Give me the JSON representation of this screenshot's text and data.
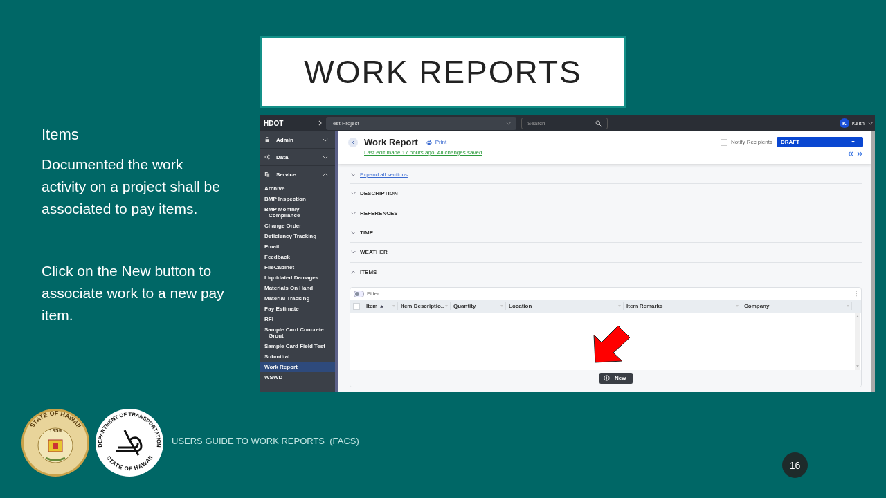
{
  "slide": {
    "title": "WORK REPORTS",
    "heading": "Items",
    "paragraphs": [
      [
        "Documented the work",
        "activity on a project shall be",
        "associated to pay items."
      ],
      [
        "Click on the New button to",
        "associate work to a new pay",
        "item."
      ]
    ],
    "state_seal": {
      "top": "STATE OF HAWAII",
      "year": "1959"
    },
    "dot_seal": {
      "top": "DEPARTMENT OF TRANSPORTATION",
      "bottom": "STATE OF HAWAII"
    },
    "footer": "USERS GUIDE TO WORK REPORTS  (FACS)",
    "page_number": "16"
  },
  "app": {
    "topbar": {
      "brand": "HDOT",
      "project": "Test Project",
      "search_placeholder": "Search",
      "user_initial": "K",
      "user_name": "Keith"
    },
    "sidebar": {
      "groups": [
        {
          "label": "Admin",
          "expanded": false
        },
        {
          "label": "Data",
          "expanded": false
        },
        {
          "label": "Service",
          "expanded": true
        }
      ],
      "items": [
        {
          "label": "Archive",
          "selected": false
        },
        {
          "label": "BMP Inspection",
          "selected": false
        },
        {
          "label": "BMP Monthly",
          "label_2": "Compliance",
          "selected": false
        },
        {
          "label": "Change Order",
          "selected": false
        },
        {
          "label": "Deficiency Tracking",
          "selected": false
        },
        {
          "label": "Email",
          "selected": false
        },
        {
          "label": "Feedback",
          "selected": false
        },
        {
          "label": "FileCabinet",
          "selected": false
        },
        {
          "label": "Liquidated Damages",
          "selected": false
        },
        {
          "label": "Materials On Hand",
          "selected": false
        },
        {
          "label": "Material Tracking",
          "selected": false
        },
        {
          "label": "Pay Estimate",
          "selected": false
        },
        {
          "label": "RFI",
          "selected": false
        },
        {
          "label": "Sample Card Concrete",
          "label_2": "Grout",
          "selected": false
        },
        {
          "label": "Sample Card Field Test",
          "selected": false
        },
        {
          "label": "Submittal",
          "selected": false
        },
        {
          "label": "Work Report",
          "selected": true
        },
        {
          "label": "WSWD",
          "selected": false
        }
      ]
    },
    "header": {
      "title": "Work Report",
      "print": "Print",
      "last_edit": "Last edit made 17 hours ago. All changes saved",
      "notify": {
        "label": "Notify Recipients",
        "checked": false
      },
      "status": "DRAFT"
    },
    "sections": {
      "expand_all": "Expand all sections",
      "list": [
        {
          "title": "DESCRIPTION",
          "expanded": false
        },
        {
          "title": "REFERENCES",
          "expanded": false
        },
        {
          "title": "TIME",
          "expanded": false
        },
        {
          "title": "WEATHER",
          "expanded": false
        },
        {
          "title": "ITEMS",
          "expanded": true
        }
      ]
    },
    "grid": {
      "filter": {
        "label": "Filter",
        "on": false
      },
      "select_all_checked": false,
      "columns": [
        {
          "label": "Item",
          "sorted": true
        },
        {
          "label": "Item Descriptio..",
          "sorted": false
        },
        {
          "label": "Quantity",
          "sorted": false
        },
        {
          "label": "Location",
          "sorted": false
        },
        {
          "label": "Item Remarks",
          "sorted": false
        },
        {
          "label": "Company",
          "sorted": false
        }
      ],
      "new_button": "New"
    }
  }
}
